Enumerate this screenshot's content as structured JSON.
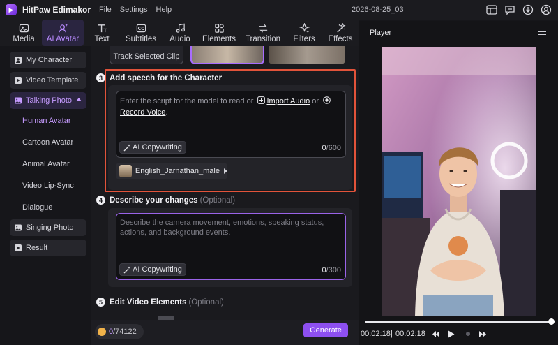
{
  "app": {
    "title": "HitPaw Edimakor",
    "menu": [
      "File",
      "Settings",
      "Help"
    ],
    "project_name": "2026-08-25_03",
    "title_icons": [
      "layout-icon",
      "feedback-icon",
      "download-icon",
      "account-icon"
    ]
  },
  "toolbar": [
    {
      "label": "Media",
      "icon": "media-icon"
    },
    {
      "label": "AI Avatar",
      "icon": "ai-avatar-icon",
      "active": true
    },
    {
      "label": "Text",
      "icon": "text-icon"
    },
    {
      "label": "Subtitles",
      "icon": "subtitles-icon"
    },
    {
      "label": "Audio",
      "icon": "audio-icon"
    },
    {
      "label": "Elements",
      "icon": "elements-icon"
    },
    {
      "label": "Transition",
      "icon": "transition-icon"
    },
    {
      "label": "Filters",
      "icon": "filters-icon"
    },
    {
      "label": "Effects",
      "icon": "effects-icon"
    }
  ],
  "sidebar": {
    "items": [
      {
        "label": "My Character",
        "icon": "character-icon"
      },
      {
        "label": "Video Template",
        "icon": "template-icon"
      },
      {
        "label": "Talking Photo",
        "icon": "photo-icon",
        "expanded": true
      },
      {
        "label": "Singing Photo",
        "icon": "singing-icon"
      },
      {
        "label": "Result",
        "icon": "result-icon"
      }
    ],
    "sub_items": [
      "Human Avatar",
      "Cartoon Avatar",
      "Animal Avatar",
      "Video Lip-Sync",
      "Dialogue"
    ],
    "active_sub": "Human Avatar"
  },
  "main": {
    "track_label": "Track Selected Clip",
    "step3": {
      "num": "3",
      "title": "Add speech for the Character"
    },
    "script": {
      "placeholder_before": "Enter the script for the model to read or",
      "import_audio": "Import Audio",
      "or": "or",
      "record_voice": "Record Voice",
      "period": "."
    },
    "ai_copywriting": "AI Copywriting",
    "script_count": {
      "current": "0",
      "max": "/600"
    },
    "voice": "English_Jarnathan_male",
    "step4": {
      "num": "4",
      "title": "Describe your changes",
      "optional": "(Optional)"
    },
    "describe_placeholder": "Describe the camera movement, emotions, speaking status, actions, and background events.",
    "describe_count": {
      "current": "0",
      "max": "/300"
    },
    "step5": {
      "num": "5",
      "title": "Edit Video Elements",
      "optional": "(Optional)"
    },
    "credits": {
      "used": "0",
      "total": "/74122"
    },
    "generate": "Generate"
  },
  "player": {
    "title": "Player",
    "time_current": "00:02:18",
    "time_total": "00:02:18",
    "progress": 1.0
  },
  "colors": {
    "accent": "#a86cff",
    "highlight_border": "#e2533a",
    "generate": "#8d4ff0"
  }
}
